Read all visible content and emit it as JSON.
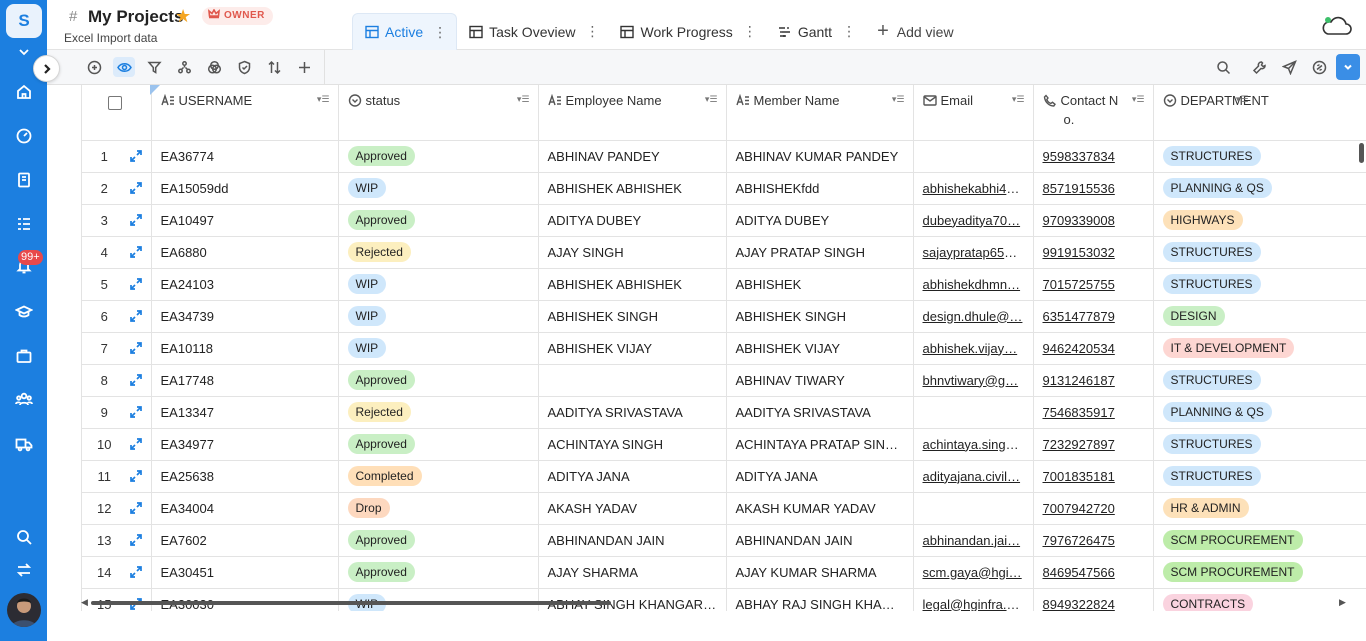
{
  "workspace": {
    "initial": "S",
    "notification_count": "99+"
  },
  "project": {
    "title": "My Projects",
    "owner_label": "OWNER",
    "subtitle": "Excel Import data"
  },
  "views": [
    {
      "label": "Active",
      "active": true
    },
    {
      "label": "Task Oveview",
      "active": false
    },
    {
      "label": "Work Progress",
      "active": false
    },
    {
      "label": "Gantt",
      "active": false
    }
  ],
  "add_view_label": "Add view",
  "columns": {
    "username": "USERNAME",
    "status": "status",
    "employee": "Employee Name",
    "member": "Member Name",
    "email": "Email",
    "contact_line1": "Contact N",
    "contact_line2": "o.",
    "department": "DEPARTMENT"
  },
  "colors": {
    "accent": "#1c7fe0",
    "rail": "#1c7fe0"
  },
  "status_colors": {
    "Approved": "#c9efc5",
    "WIP": "#cfe7fb",
    "Rejected": "#fcefbf",
    "Completed": "#ffdfb8",
    "Drop": "#fdd8bf"
  },
  "dept_colors": {
    "STRUCTURES": "#cfe7fb",
    "PLANNING & QS": "#cfe7fb",
    "HIGHWAYS": "#fde1b9",
    "DESIGN": "#c9efc5",
    "IT & DEVELOPMENT": "#fdd6d2",
    "HR & ADMIN": "#fde1b9",
    "SCM PROCUREMENT": "#bdeca9",
    "CONTRACTS": "#fad3df"
  },
  "rows": [
    {
      "n": "1",
      "username": "EA36774",
      "status": "Approved",
      "employee": "ABHINAV PANDEY",
      "member": "ABHINAV KUMAR PANDEY",
      "email": "",
      "contact": "9598337834",
      "dept": "STRUCTURES"
    },
    {
      "n": "2",
      "username": "EA15059dd",
      "status": "WIP",
      "employee": "ABHISHEK ABHISHEK",
      "member": "ABHISHEKfdd",
      "email": "abhishekabhi48…",
      "contact": "8571915536",
      "dept": "PLANNING & QS"
    },
    {
      "n": "3",
      "username": "EA10497",
      "status": "Approved",
      "employee": "ADITYA DUBEY",
      "member": "ADITYA DUBEY",
      "email": "dubeyaditya70…",
      "contact": "9709339008",
      "dept": "HIGHWAYS"
    },
    {
      "n": "4",
      "username": "EA6880",
      "status": "Rejected",
      "employee": "AJAY SINGH",
      "member": "AJAY PRATAP SINGH",
      "email": "sajaypratap656…",
      "contact": "9919153032",
      "dept": "STRUCTURES"
    },
    {
      "n": "5",
      "username": "EA24103",
      "status": "WIP",
      "employee": "ABHISHEK ABHISHEK",
      "member": "ABHISHEK",
      "email": "abhishekdhmn…",
      "contact": "7015725755",
      "dept": "STRUCTURES"
    },
    {
      "n": "6",
      "username": "EA34739",
      "status": "WIP",
      "employee": "ABHISHEK SINGH",
      "member": "ABHISHEK SINGH",
      "email": "design.dhule@…",
      "contact": "6351477879",
      "dept": "DESIGN"
    },
    {
      "n": "7",
      "username": "EA10118",
      "status": "WIP",
      "employee": "ABHISHEK VIJAY",
      "member": "ABHISHEK VIJAY",
      "email": "abhishek.vijay…",
      "contact": "9462420534",
      "dept": "IT & DEVELOPMENT"
    },
    {
      "n": "8",
      "username": "EA17748",
      "status": "Approved",
      "employee": "",
      "member": "ABHINAV TIWARY",
      "email": "bhnvtiwary@g…",
      "contact": "9131246187",
      "dept": "STRUCTURES"
    },
    {
      "n": "9",
      "username": "EA13347",
      "status": "Rejected",
      "employee": "AADITYA SRIVASTAVA",
      "member": "AADITYA SRIVASTAVA",
      "email": "",
      "contact": "7546835917",
      "dept": "PLANNING & QS"
    },
    {
      "n": "10",
      "username": "EA34977",
      "status": "Approved",
      "employee": "ACHINTAYA SINGH",
      "member": "ACHINTAYA PRATAP  SINGH",
      "email": "achintaya.singh…",
      "contact": "7232927897",
      "dept": "STRUCTURES"
    },
    {
      "n": "11",
      "username": "EA25638",
      "status": "Completed",
      "employee": "ADITYA JANA",
      "member": "ADITYA JANA",
      "email": "adityajana.civil…",
      "contact": "7001835181",
      "dept": "STRUCTURES"
    },
    {
      "n": "12",
      "username": "EA34004",
      "status": "Drop",
      "employee": "AKASH YADAV",
      "member": "AKASH KUMAR YADAV",
      "email": "",
      "contact": "7007942720",
      "dept": "HR & ADMIN"
    },
    {
      "n": "13",
      "username": "EA7602",
      "status": "Approved",
      "employee": "ABHINANDAN JAIN",
      "member": "ABHINANDAN JAIN",
      "email": "abhinandan.jai…",
      "contact": "7976726475",
      "dept": "SCM PROCUREMENT"
    },
    {
      "n": "14",
      "username": "EA30451",
      "status": "Approved",
      "employee": "AJAY SHARMA",
      "member": "AJAY KUMAR SHARMA",
      "email": "scm.gaya@hgi…",
      "contact": "8469547566",
      "dept": "SCM PROCUREMENT"
    },
    {
      "n": "15",
      "username": "EA30030",
      "status": "WIP",
      "employee": "ABHAY SINGH KHANGAROT",
      "member": "ABHAY RAJ SINGH  KHAN…",
      "email": "legal@hginfra.c…",
      "contact": "8949322824",
      "dept": "CONTRACTS"
    }
  ]
}
